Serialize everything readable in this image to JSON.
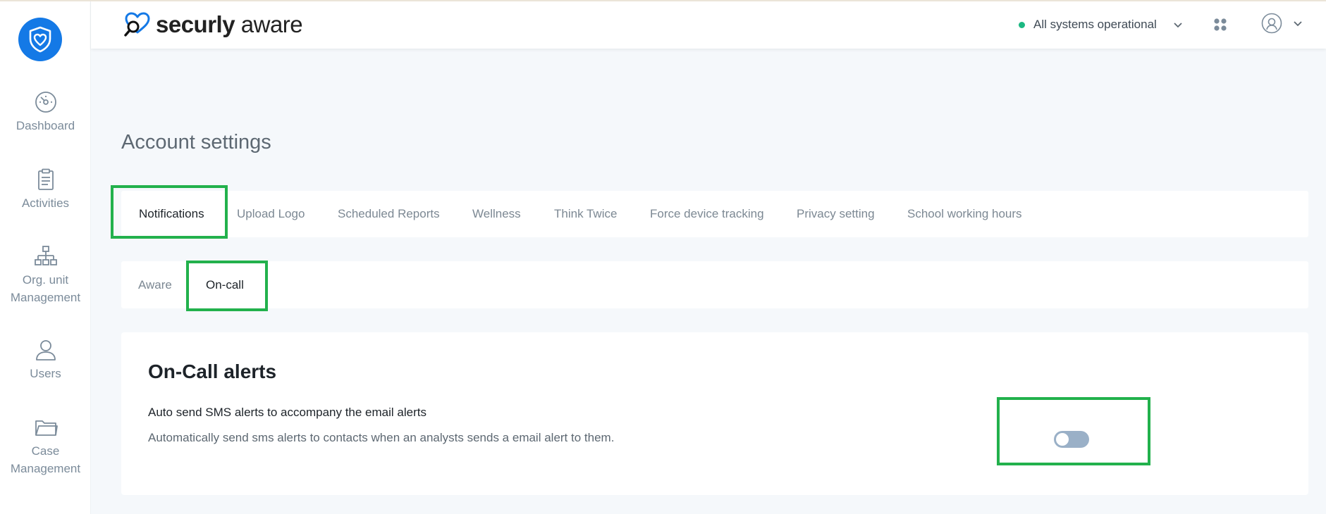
{
  "app": {
    "logo_text_bold": "securly",
    "logo_text_light": " aware",
    "brand_color": "#1479e6"
  },
  "sidebar": {
    "items": [
      {
        "label": "Dashboard",
        "icon": "gauge-icon"
      },
      {
        "label": "Activities",
        "icon": "clipboard-icon"
      },
      {
        "label_line1": "Org. unit",
        "label_line2": "Management",
        "icon": "org-chart-icon"
      },
      {
        "label": "Users",
        "icon": "user-icon"
      },
      {
        "label_line1": "Case",
        "label_line2": "Management",
        "icon": "folder-icon"
      }
    ]
  },
  "header": {
    "status_text": "All systems operational",
    "status_color": "#1cb882"
  },
  "page": {
    "title": "Account settings"
  },
  "tabs": [
    {
      "label": "Notifications",
      "active": true
    },
    {
      "label": "Upload Logo"
    },
    {
      "label": "Scheduled Reports"
    },
    {
      "label": "Wellness"
    },
    {
      "label": "Think Twice"
    },
    {
      "label": "Force device tracking"
    },
    {
      "label": "Privacy setting"
    },
    {
      "label": "School working hours"
    }
  ],
  "subtabs": [
    {
      "label": "Aware"
    },
    {
      "label": "On-call",
      "active": true
    }
  ],
  "card": {
    "title": "On-Call alerts",
    "setting_title": "Auto send SMS alerts to accompany the email alerts",
    "setting_description": "Automatically send sms alerts to contacts when an analysts sends a email alert to them.",
    "toggle_on": false
  },
  "highlight_color": "#22b14c"
}
